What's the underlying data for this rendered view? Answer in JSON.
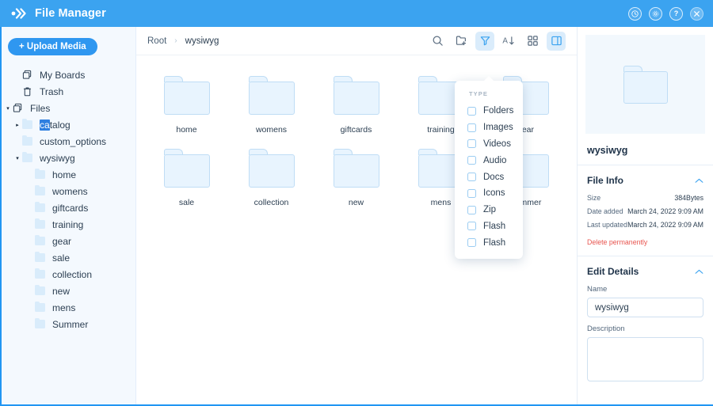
{
  "header": {
    "title": "File Manager",
    "logo_icon": "chevrons-logo-icon",
    "actions": [
      {
        "name": "history-button",
        "icon": "clock-icon",
        "glyph": "◴"
      },
      {
        "name": "settings-button",
        "icon": "gear-icon",
        "glyph": "⚙"
      },
      {
        "name": "help-button",
        "icon": "question-icon",
        "glyph": "?"
      },
      {
        "name": "close-button",
        "icon": "close-icon",
        "glyph": "✕"
      }
    ]
  },
  "sidebar": {
    "upload_label": "+ Upload Media",
    "items": [
      {
        "label": "My Boards",
        "icon": "boards-icon",
        "level": 0,
        "caret": ""
      },
      {
        "label": "Trash",
        "icon": "trash-icon",
        "level": 0,
        "caret": ""
      },
      {
        "label": "Files",
        "icon": "boards-icon",
        "level": 0,
        "caret": "▾"
      }
    ],
    "files_children": [
      {
        "label": "catalog",
        "level": 2,
        "caret": "▸",
        "selected_prefix": "ca",
        "rest": "talog"
      },
      {
        "label": "custom_options",
        "level": 2,
        "caret": ""
      },
      {
        "label": "wysiwyg",
        "level": 2,
        "caret": "▾"
      },
      {
        "label": "home",
        "level": 3,
        "caret": ""
      },
      {
        "label": "womens",
        "level": 3,
        "caret": ""
      },
      {
        "label": "giftcards",
        "level": 3,
        "caret": ""
      },
      {
        "label": "training",
        "level": 3,
        "caret": ""
      },
      {
        "label": "gear",
        "level": 3,
        "caret": ""
      },
      {
        "label": "sale",
        "level": 3,
        "caret": ""
      },
      {
        "label": "collection",
        "level": 3,
        "caret": ""
      },
      {
        "label": "new",
        "level": 3,
        "caret": ""
      },
      {
        "label": "mens",
        "level": 3,
        "caret": ""
      },
      {
        "label": "Summer",
        "level": 3,
        "caret": ""
      }
    ]
  },
  "toolbar": {
    "breadcrumb": [
      {
        "label": "Root",
        "current": false
      },
      {
        "label": "wysiwyg",
        "current": true
      }
    ],
    "separator": "›",
    "tools": [
      {
        "name": "search-button",
        "icon": "search-icon",
        "active": false
      },
      {
        "name": "new-folder-button",
        "icon": "folder-plus-icon",
        "active": false
      },
      {
        "name": "filter-button",
        "icon": "filter-funnel-icon",
        "active": true
      },
      {
        "name": "sort-button",
        "icon": "sort-alpha-down-icon",
        "active": false
      },
      {
        "name": "grid-view-button",
        "icon": "grid-view-icon",
        "active": false
      },
      {
        "name": "details-panel-button",
        "icon": "side-panel-icon",
        "active": true
      }
    ]
  },
  "filter_dropdown": {
    "title": "TYPE",
    "options": [
      {
        "label": "Folders",
        "checked": false
      },
      {
        "label": "Images",
        "checked": false
      },
      {
        "label": "Videos",
        "checked": false
      },
      {
        "label": "Audio",
        "checked": false
      },
      {
        "label": "Docs",
        "checked": false
      },
      {
        "label": "Icons",
        "checked": false
      },
      {
        "label": "Zip",
        "checked": false
      },
      {
        "label": "Flash",
        "checked": false
      },
      {
        "label": "Flash",
        "checked": false
      }
    ]
  },
  "grid": {
    "rows": [
      [
        "home",
        "womens",
        "giftcards",
        "training",
        "gear"
      ],
      [
        "sale",
        "collection",
        "new",
        "mens",
        "Summer"
      ]
    ]
  },
  "details_panel": {
    "preview_icon": "folder-icon",
    "item_name": "wysiwyg",
    "file_info": {
      "title": "File Info",
      "collapse_icon": "chevron-up-icon",
      "rows": [
        {
          "key": "Size",
          "value": "384Bytes"
        },
        {
          "key": "Date added",
          "value": "March 24, 2022 9:09 AM"
        },
        {
          "key": "Last updated",
          "value": "March 24, 2022 9:09 AM"
        }
      ],
      "delete_label": "Delete permanently"
    },
    "edit_details": {
      "title": "Edit Details",
      "collapse_icon": "chevron-up-icon",
      "name_label": "Name",
      "name_value": "wysiwyg",
      "name_placeholder": "Name",
      "description_label": "Description",
      "description_value": "",
      "description_placeholder": ""
    }
  },
  "colors": {
    "brand": "#3ba3f0",
    "accent_active": "#daecfb",
    "folder_fill": "#e8f4fe",
    "folder_stroke": "#bfddf5",
    "danger": "#e8554f"
  }
}
